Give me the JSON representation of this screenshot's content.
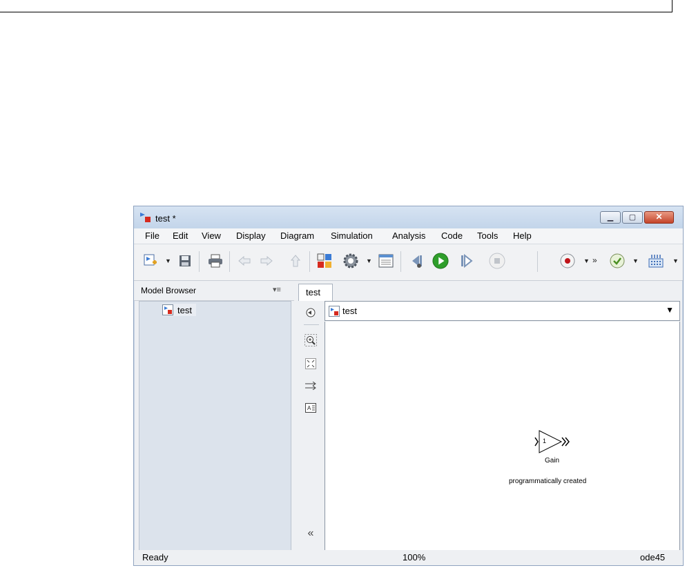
{
  "window": {
    "title": "test *"
  },
  "menu": [
    "File",
    "Edit",
    "View",
    "Display",
    "Diagram",
    "Simulation",
    "Analysis",
    "Code",
    "Tools",
    "Help"
  ],
  "model_browser": {
    "title": "Model Browser",
    "items": [
      {
        "label": "test"
      }
    ]
  },
  "tabs": [
    {
      "label": "test"
    }
  ],
  "address": {
    "path": "test"
  },
  "canvas": {
    "block": {
      "value": "1",
      "name": "Gain",
      "annotation": "programmatically created"
    }
  },
  "status": {
    "left": "Ready",
    "zoom": "100%",
    "solver": "ode45"
  },
  "colors": {
    "titlebar": "#c3d5ea",
    "close_button": "#c4452b",
    "run_green": "#2f9e2b",
    "record_red": "#c0141a",
    "model_icon_red": "#d62a1e"
  }
}
